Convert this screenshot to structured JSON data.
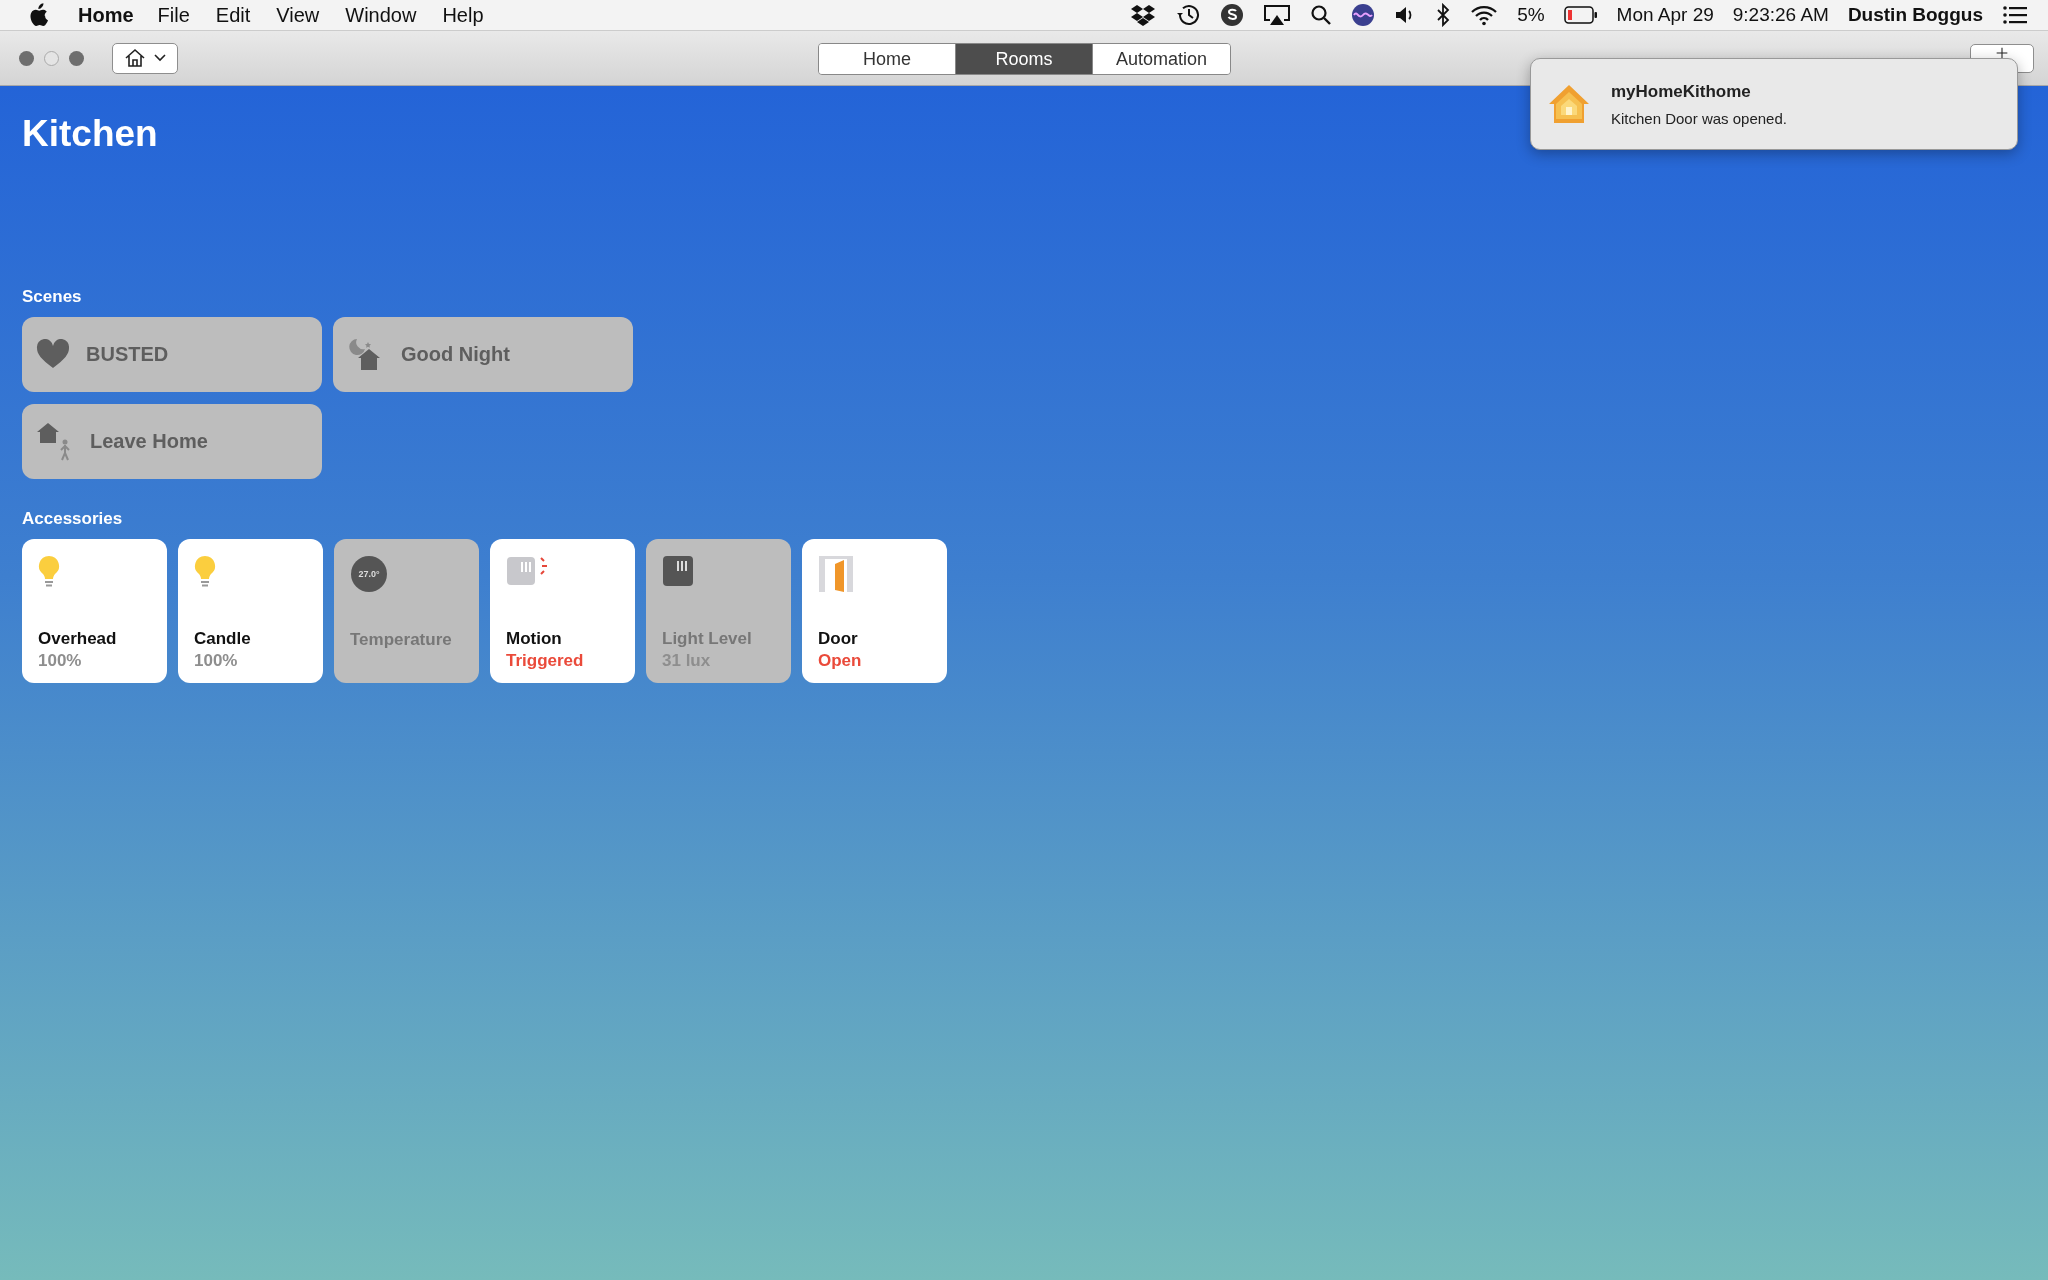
{
  "menu_bar": {
    "app": "Home",
    "items": [
      "File",
      "Edit",
      "View",
      "Window",
      "Help"
    ],
    "battery": "5%",
    "date": "Mon Apr 29",
    "time": "9:23:26 AM",
    "user": "Dustin Boggus"
  },
  "toolbar": {
    "tabs": [
      {
        "label": "Home",
        "selected": false
      },
      {
        "label": "Rooms",
        "selected": true
      },
      {
        "label": "Automation",
        "selected": false
      }
    ]
  },
  "notification": {
    "title": "myHomeKithome",
    "body": "Kitchen Door was opened."
  },
  "room": {
    "title": "Kitchen"
  },
  "scenes": {
    "heading": "Scenes",
    "items": [
      {
        "name": "BUSTED",
        "kind": "heart",
        "on": false
      },
      {
        "name": "Good Night",
        "kind": "night",
        "on": false
      },
      {
        "name": "Leave Home",
        "kind": "leave",
        "on": false
      }
    ]
  },
  "accessories": {
    "heading": "Accessories",
    "items": [
      {
        "name": "Overhead",
        "status": "100%",
        "kind": "bulb",
        "on": true,
        "alert": false
      },
      {
        "name": "Candle",
        "status": "100%",
        "kind": "bulb",
        "on": true,
        "alert": false
      },
      {
        "name": "Temperature",
        "kind": "thermometer",
        "reading": "27.0°",
        "on": false
      },
      {
        "name": "Motion",
        "status": "Triggered",
        "kind": "motion",
        "on": true,
        "alert": true
      },
      {
        "name": "Light Level",
        "status": "31 lux",
        "kind": "light-sensor",
        "on": false,
        "alert": false
      },
      {
        "name": "Door",
        "status": "Open",
        "kind": "door",
        "on": true,
        "alert": true
      }
    ]
  }
}
